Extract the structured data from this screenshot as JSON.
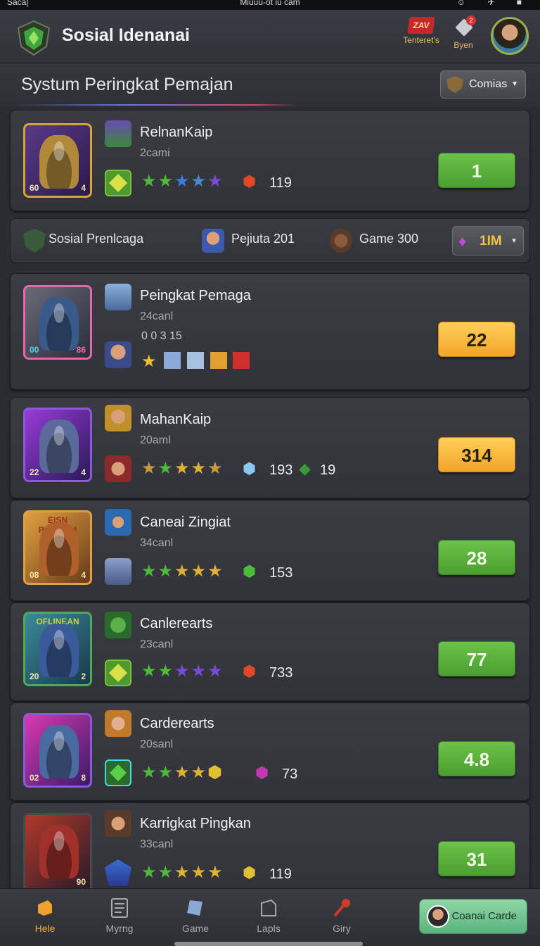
{
  "status_bar": {
    "left": "Saca|",
    "center": "Miuuu-ot iu cam",
    "right": "☺ ✈ ■"
  },
  "header": {
    "title": "Sosial Idenanai",
    "btn_t_icon": "ZAV",
    "btn_t_label": "Tenteret's",
    "btn_o_badge": "2",
    "btn_o_label": "Byen"
  },
  "section": {
    "title": "Systum Peringkat Pemajan",
    "dropdown": "Comias"
  },
  "filter": {
    "item1": "Sosial Prenlcaga",
    "item2": "Pejiuta 201",
    "item3": "Game 300",
    "dropdown": "1IM"
  },
  "entries": [
    {
      "name": "RelnanKaip",
      "sub": "2cami",
      "stats": "119",
      "rank": "1",
      "portrait_left": "60",
      "portrait_right": "4"
    },
    {
      "name": "Peingkat Pemaga",
      "sub": "24canl",
      "stats": "0 0 3  15",
      "rank": "22",
      "portrait_left": "00",
      "portrait_right": "86"
    },
    {
      "name": "MahanKaip",
      "sub": "20aml",
      "stats": "193",
      "stats2": "19",
      "rank": "314",
      "portrait_left": "22",
      "portrait_right": "4"
    },
    {
      "name": "Caneai Zingiat",
      "sub": "34canl",
      "stats": "153",
      "rank": "28",
      "portrait_left": "08",
      "portrait_right": "4",
      "banner": "EISN PEEIHAM"
    },
    {
      "name": "Canlerearts",
      "sub": "23canl",
      "stats": "733",
      "rank": "77",
      "portrait_left": "20",
      "portrait_right": "2",
      "banner": "OFLINEAN"
    },
    {
      "name": "Carderearts",
      "sub": "20sanl",
      "stats": "73",
      "rank": "4.8",
      "portrait_left": "02",
      "portrait_right": "8"
    },
    {
      "name": "Karrigkat Pingkan",
      "sub": "33canl",
      "stats": "119",
      "rank": "31",
      "portrait_left": "",
      "portrait_right": "90"
    }
  ],
  "bottom_nav": [
    {
      "label": "Hele"
    },
    {
      "label": "Myrng"
    },
    {
      "label": "Game"
    },
    {
      "label": "Lapls"
    },
    {
      "label": "Giry"
    }
  ],
  "cta": "Coanai Carde",
  "colors": {
    "rank_green": "#5cb23a",
    "rank_orange": "#f5b23a",
    "background": "#2b2c31"
  },
  "icons": [
    "shield-logo-icon",
    "avatar",
    "star-icon",
    "gem-icon",
    "home-icon",
    "list-icon",
    "game-icon",
    "laps-icon",
    "key-icon"
  ]
}
